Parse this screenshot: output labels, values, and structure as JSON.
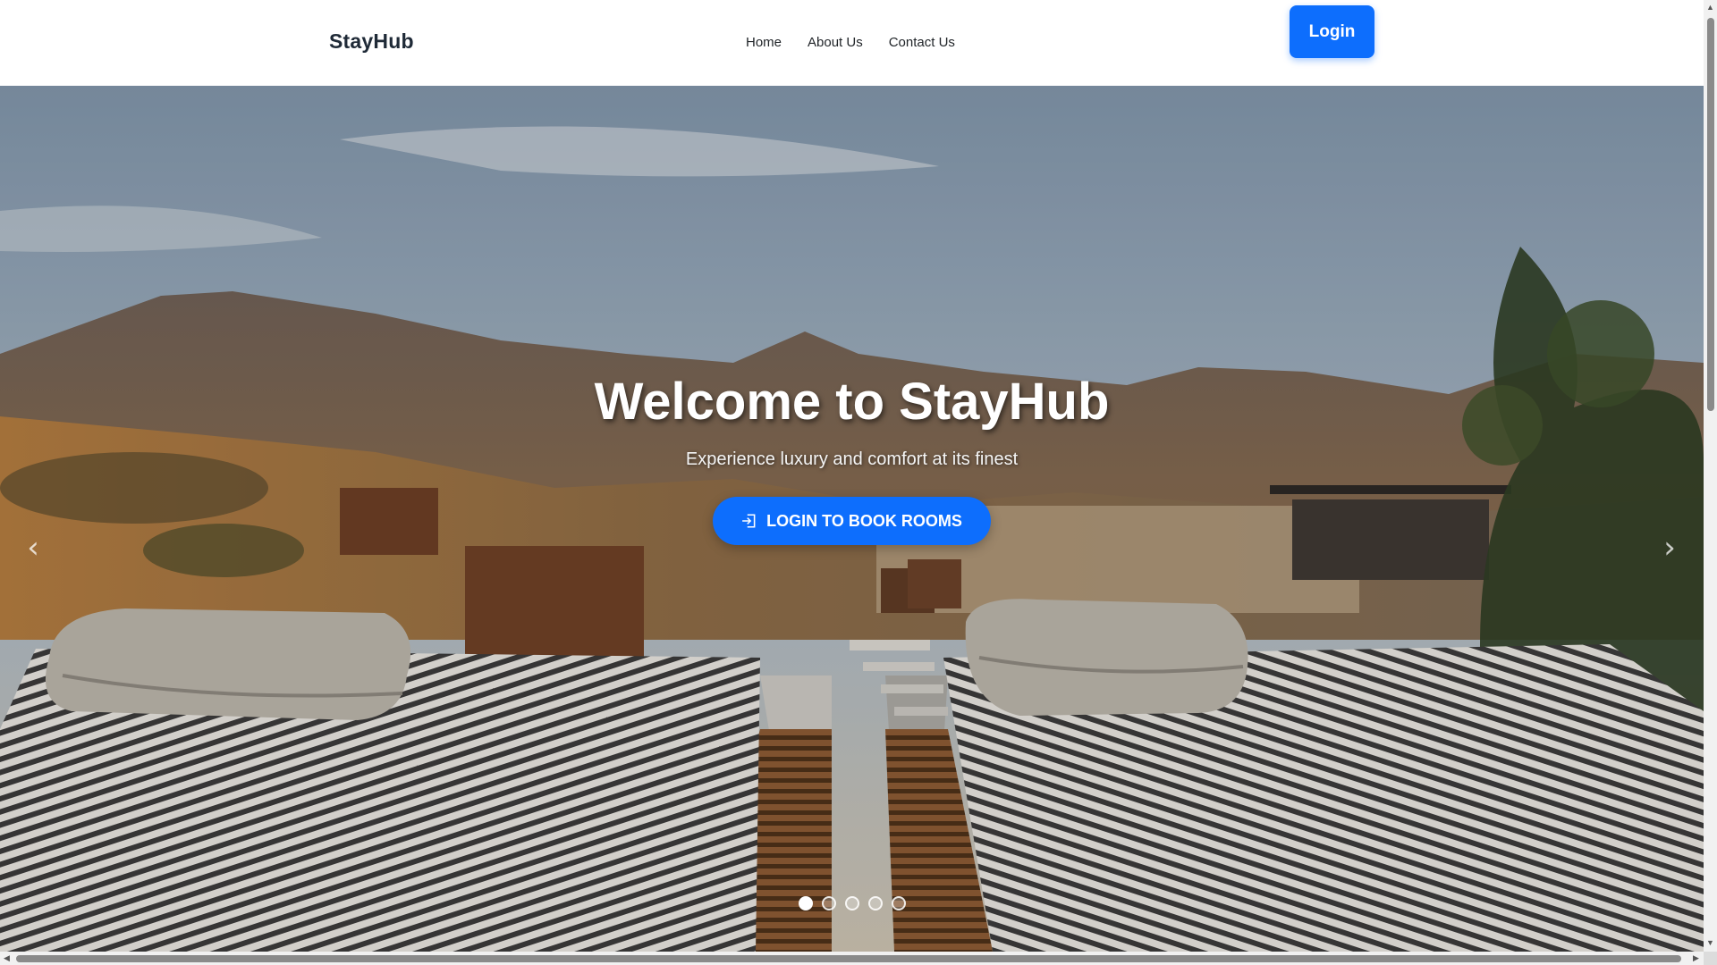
{
  "navbar": {
    "brand": "StayHub",
    "links": [
      "Home",
      "About Us",
      "Contact Us"
    ],
    "login_label": "Login",
    "accent": "#0d6efd"
  },
  "hero": {
    "title": "Welcome to StayHub",
    "subtitle": "Experience luxury and comfort at its finest",
    "cta_label": "LOGIN TO BOOK ROOMS",
    "cta_icon": "login-icon",
    "prev_icon": "chevron-left-icon",
    "next_icon": "chevron-right-icon",
    "slide_count": 5,
    "active_slide": 1
  },
  "scroll": {
    "up_glyph": "▲",
    "down_glyph": "▼",
    "left_glyph": "◀",
    "right_glyph": "▶"
  }
}
